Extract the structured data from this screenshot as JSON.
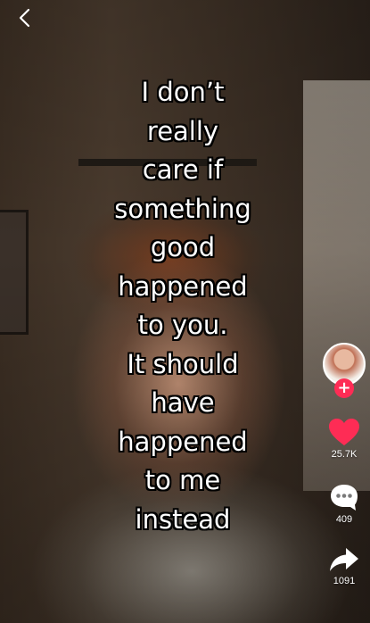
{
  "caption": {
    "lines": [
      "I don’t",
      "really",
      "care if",
      "something",
      "good",
      "happened",
      "to you.",
      "It should",
      "have",
      "happened",
      "to me",
      "instead"
    ]
  },
  "actions": {
    "likes": "25.7K",
    "comments": "409",
    "shares": "1091"
  },
  "icons": {
    "back": "chevron-left-icon",
    "follow": "plus-icon",
    "like": "heart-icon",
    "comment": "comment-dots-icon",
    "share": "share-arrow-icon"
  },
  "colors": {
    "like": "#fe2c55",
    "follow": "#fe2c55",
    "text": "#ffffff"
  }
}
